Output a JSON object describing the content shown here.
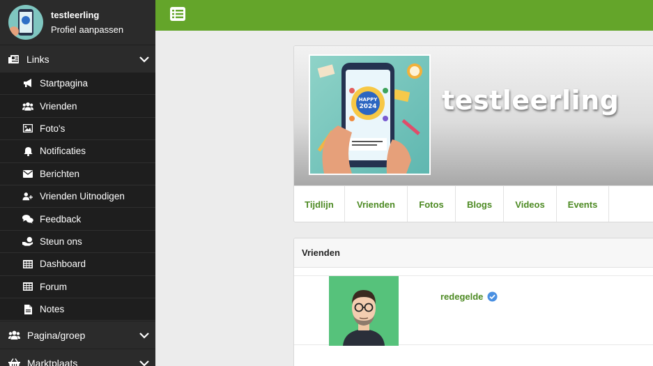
{
  "user": {
    "name": "testleerling",
    "subtitle": "Profiel aanpassen"
  },
  "sidebar": {
    "links_section": {
      "label": "Links",
      "icon": "newspaper-icon"
    },
    "items": [
      {
        "label": "Startpagina",
        "icon": "megaphone-icon"
      },
      {
        "label": "Vrienden",
        "icon": "users-icon"
      },
      {
        "label": "Foto's",
        "icon": "image-icon"
      },
      {
        "label": "Notificaties",
        "icon": "bell-icon"
      },
      {
        "label": "Berichten",
        "icon": "envelope-icon"
      },
      {
        "label": "Vrienden Uitnodigen",
        "icon": "user-plus-icon"
      },
      {
        "label": "Feedback",
        "icon": "comments-icon"
      },
      {
        "label": "Steun ons",
        "icon": "donate-icon"
      },
      {
        "label": "Dashboard",
        "icon": "table-icon"
      },
      {
        "label": "Forum",
        "icon": "table-icon"
      },
      {
        "label": "Notes",
        "icon": "file-icon"
      }
    ],
    "groups_section": {
      "label": "Pagina/groep",
      "icon": "users-icon"
    },
    "market_section": {
      "label": "Marktplaats",
      "icon": "basket-icon"
    }
  },
  "profile": {
    "name": "testleerling",
    "tabs": [
      "Tijdlijn",
      "Vrienden",
      "Fotos",
      "Blogs",
      "Videos",
      "Events"
    ]
  },
  "friends": {
    "title": "Vrienden",
    "items": [
      {
        "name": "redegelde",
        "verified": true
      }
    ]
  },
  "colors": {
    "topbar": "#64a52a",
    "sidebar": "#2b2b2b",
    "link": "#4d8a23",
    "verified": "#4a90e2"
  }
}
